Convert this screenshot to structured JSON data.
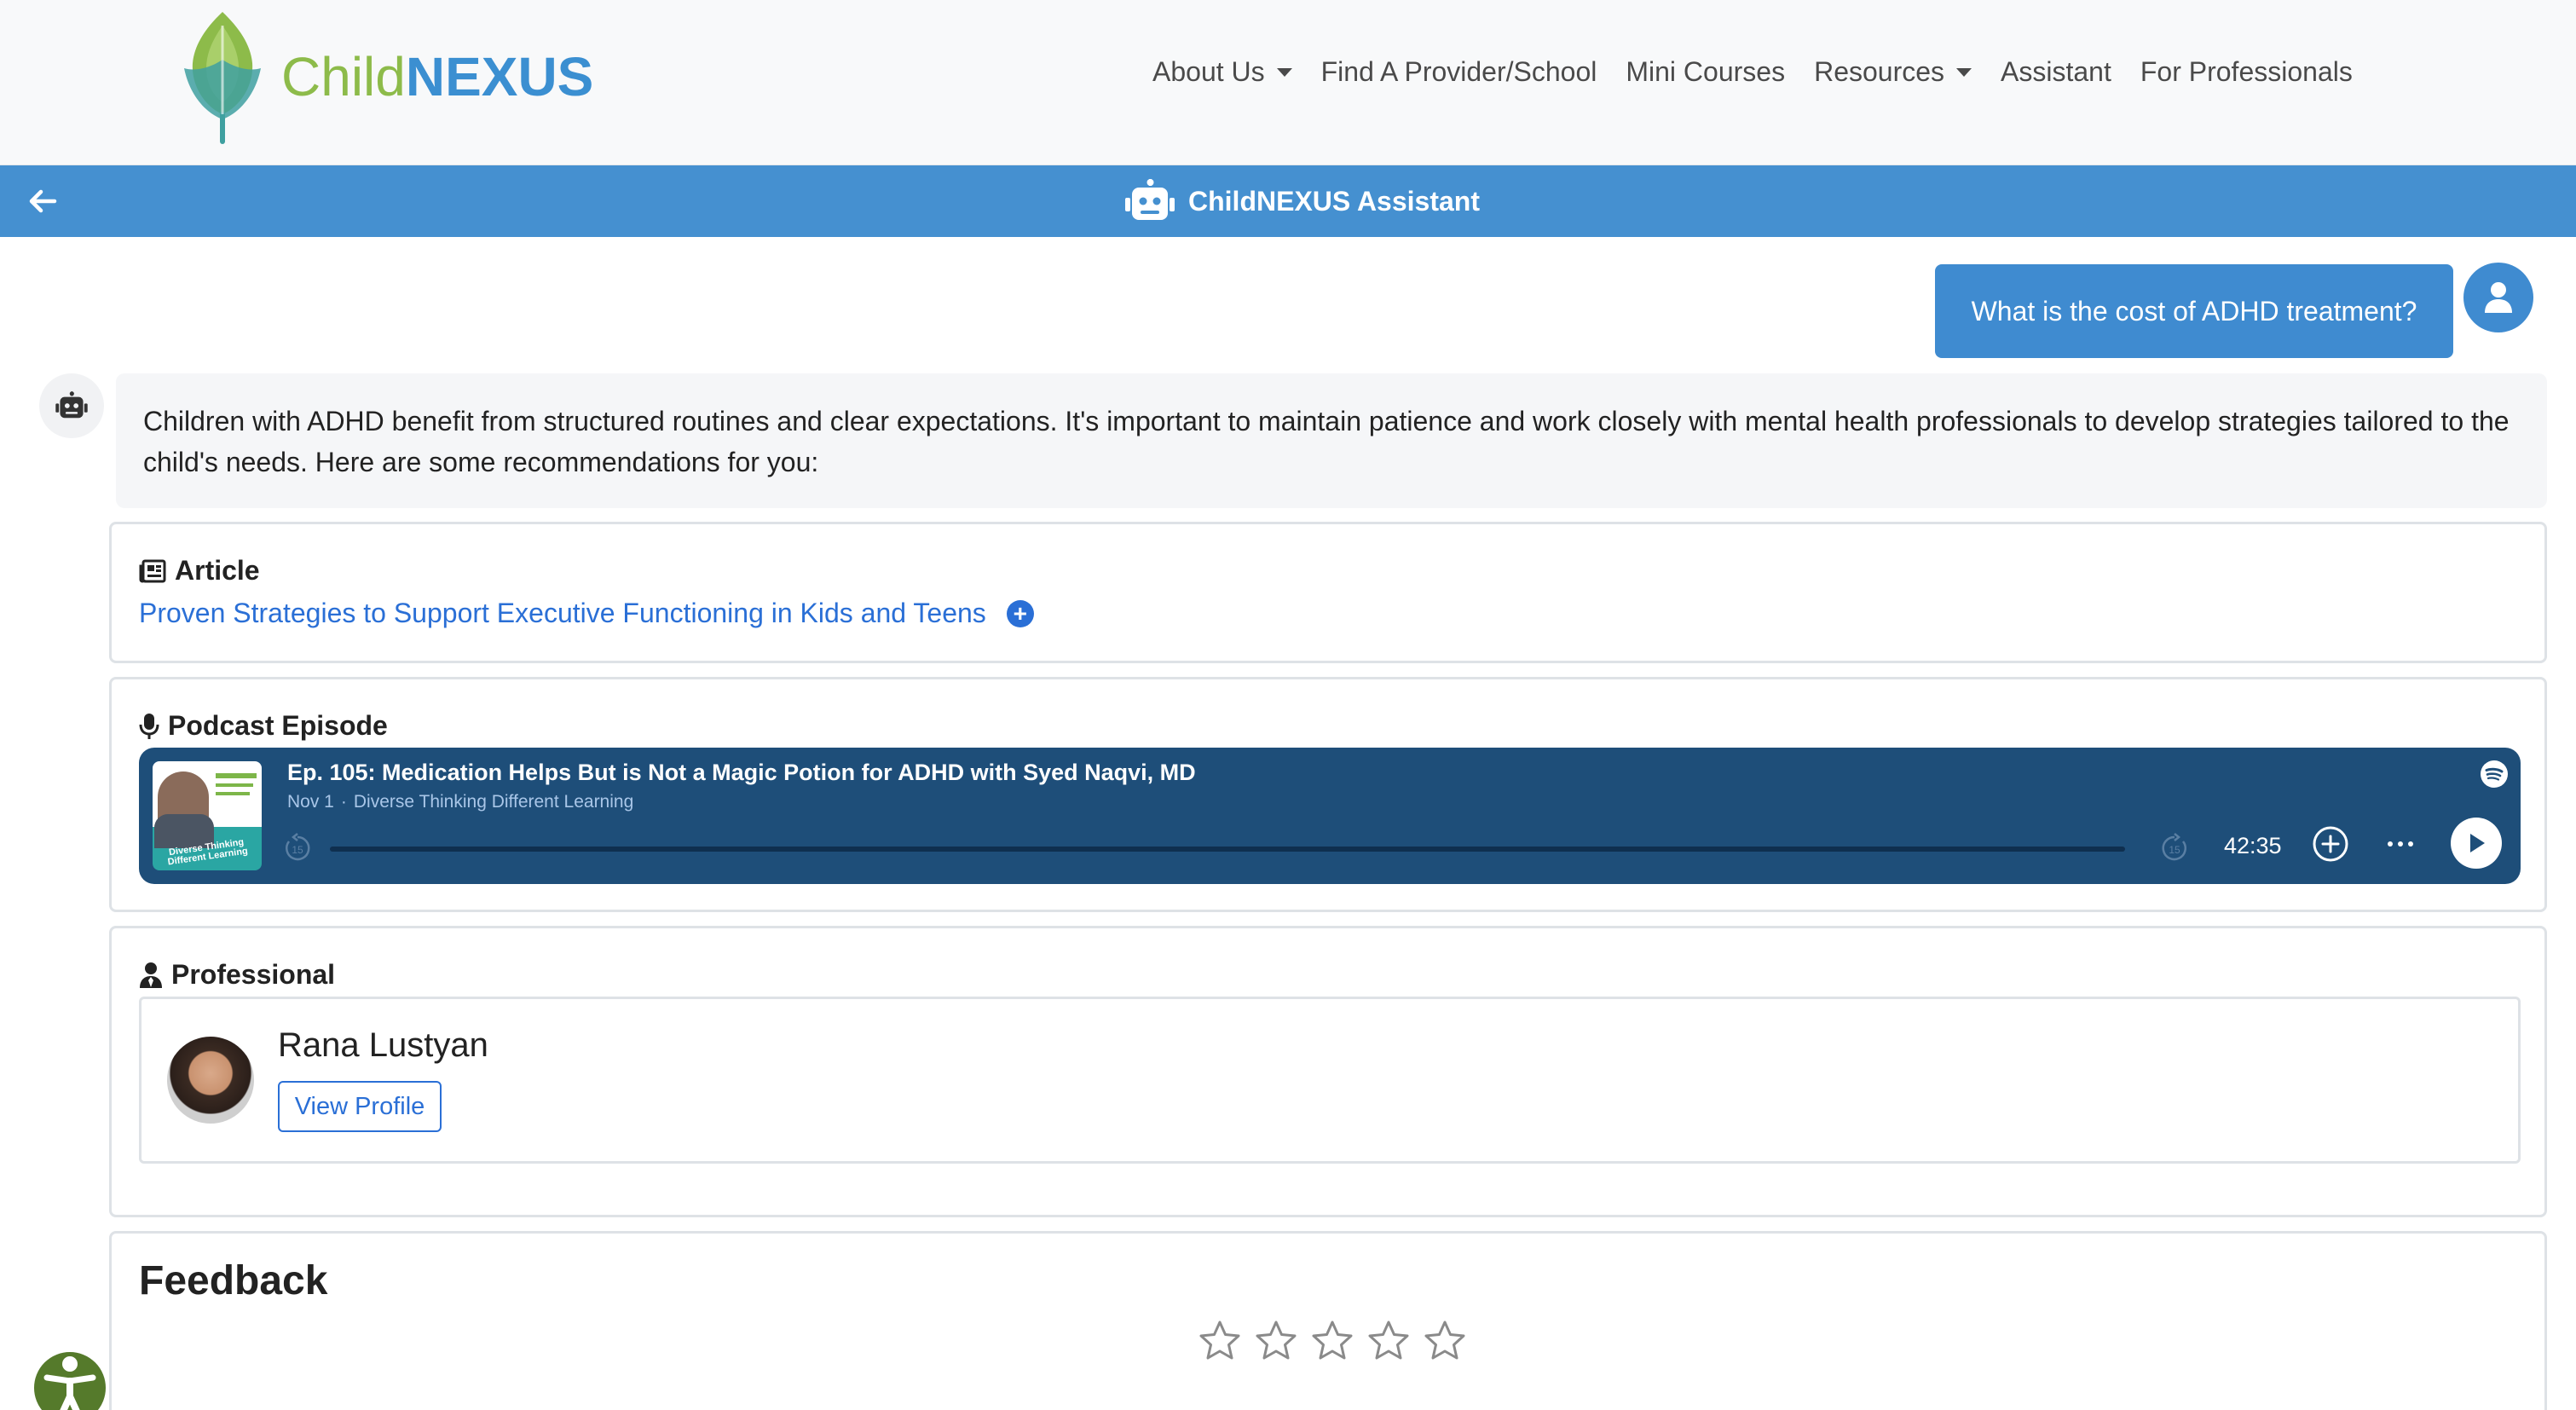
{
  "brand": {
    "child": "Child",
    "nexus": "NEXUS",
    "child_color": "#8dbb4a",
    "nexus_color": "#3b8fd1"
  },
  "nav": {
    "items": [
      {
        "label": "About Us",
        "dropdown": true
      },
      {
        "label": "Find A Provider/School",
        "dropdown": false
      },
      {
        "label": "Mini Courses",
        "dropdown": false
      },
      {
        "label": "Resources",
        "dropdown": true
      },
      {
        "label": "Assistant",
        "dropdown": false
      },
      {
        "label": "For Professionals",
        "dropdown": false
      }
    ]
  },
  "assistant_bar": {
    "title": "ChildNEXUS Assistant",
    "back_icon": "arrow-left-icon",
    "bot_icon": "robot-icon",
    "color": "#4590d0"
  },
  "chat": {
    "user_message": "What is the cost of ADHD treatment?",
    "bot_message": "Children with ADHD benefit from structured routines and clear expectations. It's important to maintain patience and work closely with mental health professionals to develop strategies tailored to the child's needs. Here are some recommendations for you:"
  },
  "article": {
    "heading": "Article",
    "icon": "newspaper-icon",
    "link": "Proven Strategies to Support Executive Functioning in Kids and Teens"
  },
  "podcast": {
    "heading": "Podcast Episode",
    "icon": "microphone-icon",
    "title": "Ep. 105: Medication Helps But is Not a Magic Potion for ADHD with Syed Naqvi, MD",
    "date": "Nov 1",
    "show": "Diverse Thinking Different Learning",
    "duration": "42:35",
    "art_band": "Diverse Thinking Different Learning",
    "player_color": "#1e4e79"
  },
  "professional": {
    "heading": "Professional",
    "icon": "user-tie-icon",
    "name": "Rana Lustyan",
    "button": "View Profile"
  },
  "feedback": {
    "heading": "Feedback",
    "star_count": 5,
    "rating": 0
  }
}
